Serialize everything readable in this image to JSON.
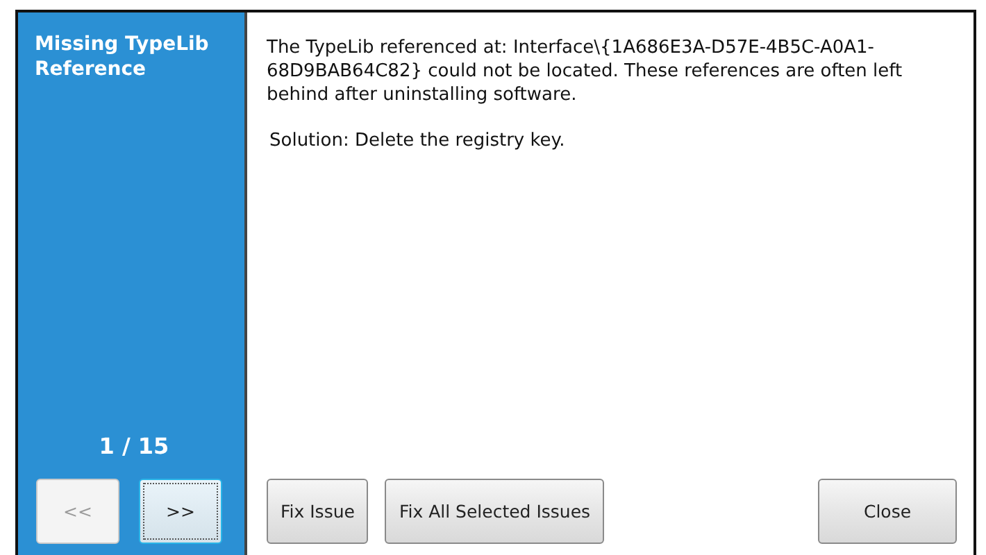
{
  "sidebar": {
    "title": "Missing TypeLib Reference",
    "counter": "1 / 15",
    "nav_buttons": [
      {
        "label": "<<",
        "disabled": true,
        "focused": false
      },
      {
        "label": ">>",
        "disabled": false,
        "focused": true
      }
    ]
  },
  "issue": {
    "description": "The TypeLib referenced at: Interface\\{1A686E3A-D57E-4B5C-A0A1-68D9BAB64C82} could not be located. These references are often left behind after uninstalling software.",
    "solution": "Solution: Delete the registry key."
  },
  "buttons": [
    {
      "label": "Fix Issue",
      "kind": "action"
    },
    {
      "label": "Fix All Selected Issues",
      "kind": "action"
    },
    {
      "label": "Close",
      "kind": "dismiss"
    }
  ]
}
